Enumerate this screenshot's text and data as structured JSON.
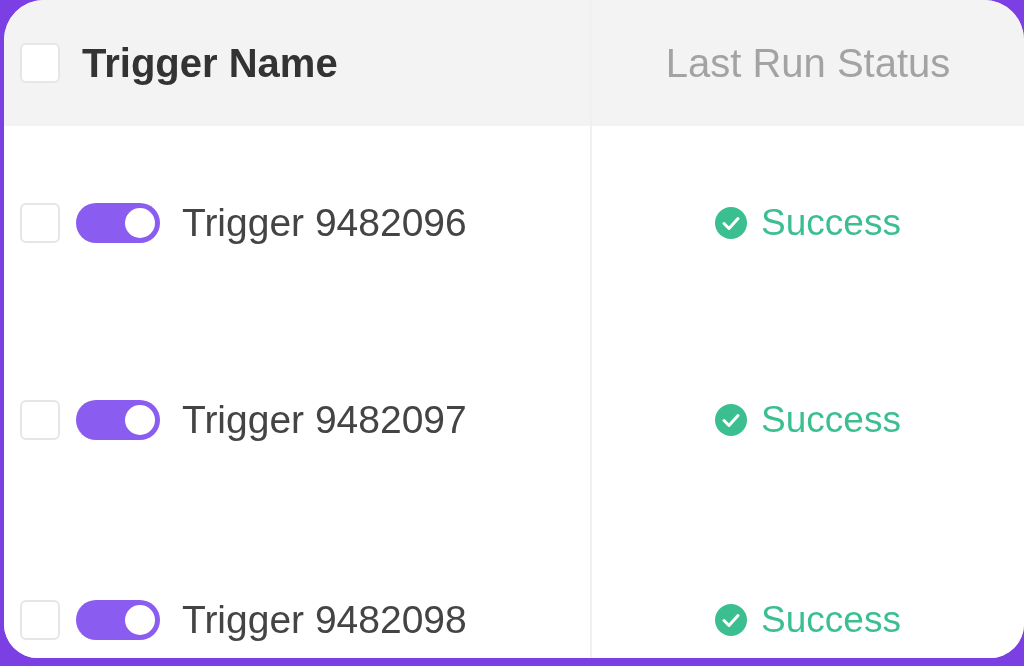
{
  "table": {
    "select_all": {
      "checked": false
    },
    "columns": [
      "Trigger Name",
      "Last Run Status"
    ],
    "rows": [
      {
        "checked": false,
        "on": true,
        "name": "Trigger 9482096",
        "status": {
          "kind": "success",
          "label": "Success"
        }
      },
      {
        "checked": false,
        "on": true,
        "name": "Trigger 9482097",
        "status": {
          "kind": "success",
          "label": "Success"
        }
      },
      {
        "checked": false,
        "on": true,
        "name": "Trigger 9482098",
        "status": {
          "kind": "success",
          "label": "Success"
        }
      }
    ]
  }
}
